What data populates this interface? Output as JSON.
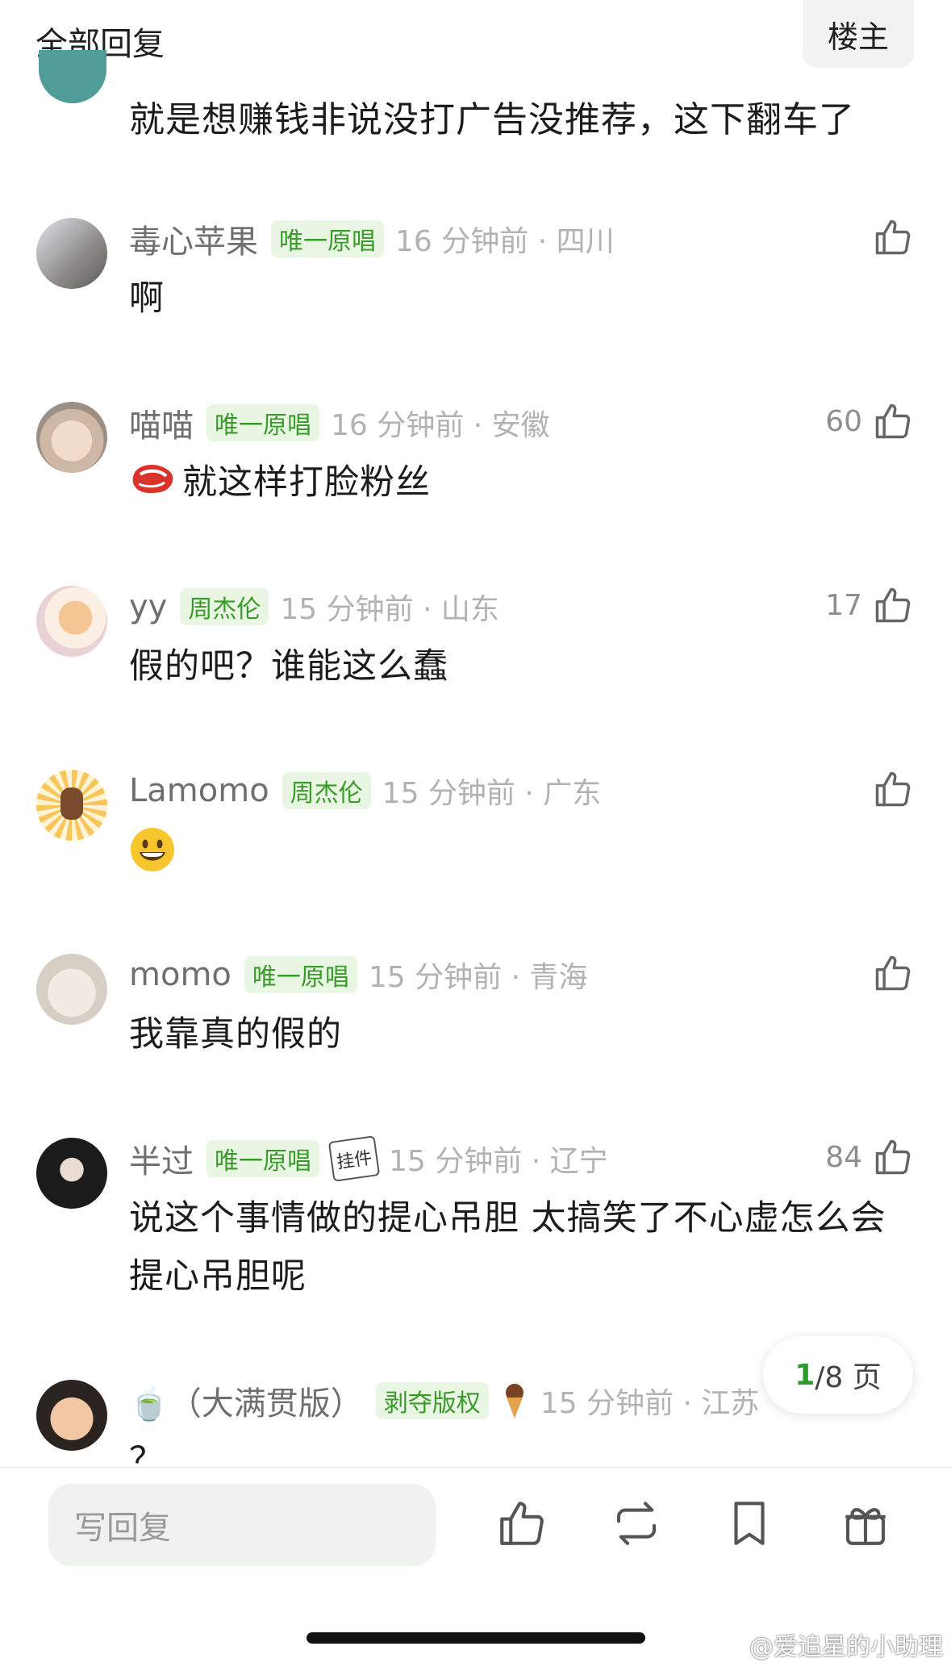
{
  "header": {
    "title": "全部回复",
    "op_label": "楼主"
  },
  "top_comment": {
    "text": "就是想赚钱非说没打广告没推荐，这下翻车了"
  },
  "comments": [
    {
      "user": "毒心苹果",
      "badge": "唯一原唱",
      "time": "16 分钟前 · 四川",
      "likes": "",
      "text": "啊"
    },
    {
      "user": "喵喵",
      "badge": "唯一原唱",
      "time": "16 分钟前 · 安徽",
      "likes": "60",
      "text": "就这样打脸粉丝"
    },
    {
      "user": "yy",
      "badge": "周杰伦",
      "time": "15 分钟前 · 山东",
      "likes": "17",
      "text": "假的吧？谁能这么蠢"
    },
    {
      "user": "Lamomo",
      "badge": "周杰伦",
      "time": "15 分钟前 · 广东",
      "likes": "",
      "text": "😀"
    },
    {
      "user": "momo",
      "badge": "唯一原唱",
      "time": "15 分钟前 · 青海",
      "likes": "",
      "text": "我靠真的假的"
    },
    {
      "user": "半过",
      "badge": "唯一原唱",
      "pendant": "挂件",
      "time": "15 分钟前 · 辽宁",
      "likes": "84",
      "text": "说这个事情做的提心吊胆 太搞笑了不心虚怎么会提心吊胆呢"
    },
    {
      "user": "🍵（大满贯版）",
      "badge": "剥夺版权",
      "time": "15 分钟前 · 江苏",
      "likes": "",
      "text": "？"
    }
  ],
  "pagination": {
    "current": "1",
    "total_suffix": "/8 页"
  },
  "bottom_bar": {
    "reply_placeholder": "写回复"
  },
  "watermark": "@爱追星的小助理",
  "colors": {
    "badge_bg": "#eaf6e4",
    "badge_text": "#3a9b2a",
    "page_current": "#2e9b2e"
  }
}
